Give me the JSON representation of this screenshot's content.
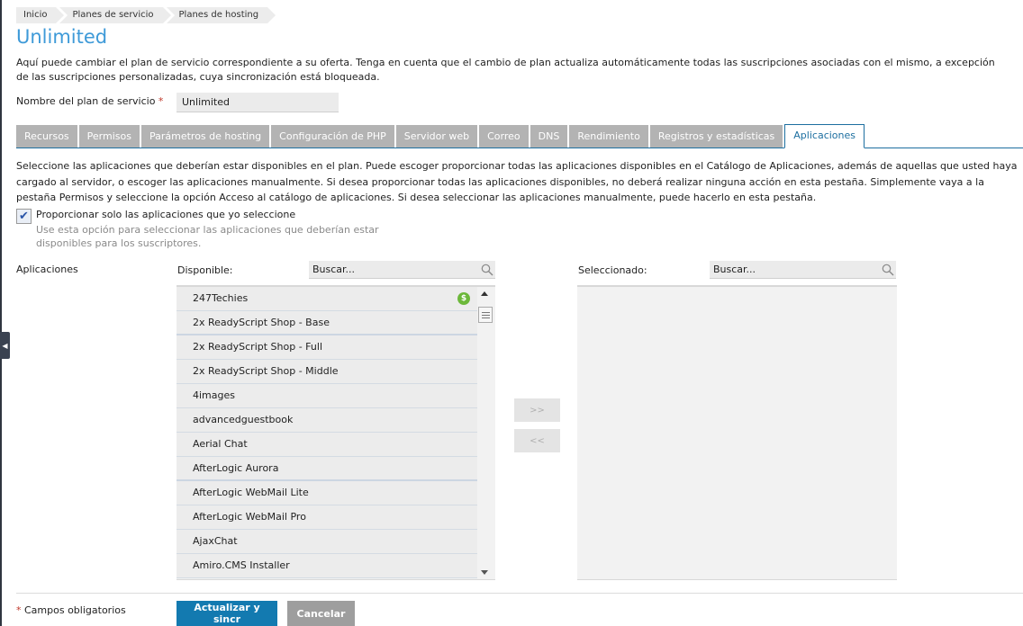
{
  "breadcrumb": [
    "Inicio",
    "Planes de servicio",
    "Planes de hosting"
  ],
  "page": {
    "title": "Unlimited",
    "intro": "Aquí puede cambiar el plan de servicio correspondiente a su oferta. Tenga en cuenta que el cambio de plan actualiza automáticamente todas las suscripciones asociadas con el mismo, a excepción de las suscripciones personalizadas, cuya sincronización está bloqueada."
  },
  "plan_name": {
    "label": "Nombre del plan de servicio",
    "required_mark": "*",
    "value": "Unlimited"
  },
  "tabs": [
    {
      "label": "Recursos",
      "active": false
    },
    {
      "label": "Permisos",
      "active": false
    },
    {
      "label": "Parámetros de hosting",
      "active": false
    },
    {
      "label": "Configuración de PHP",
      "active": false
    },
    {
      "label": "Servidor web",
      "active": false
    },
    {
      "label": "Correo",
      "active": false
    },
    {
      "label": "DNS",
      "active": false
    },
    {
      "label": "Rendimiento",
      "active": false
    },
    {
      "label": "Registros y estadísticas",
      "active": false
    },
    {
      "label": "Aplicaciones",
      "active": true
    }
  ],
  "applications_tab": {
    "description": "Seleccione las aplicaciones que deberían estar disponibles en el plan. Puede escoger proporcionar todas las aplicaciones disponibles en el Catálogo de Aplicaciones, además de aquellas que usted haya cargado al servidor, o escoger las aplicaciones manualmente. Si desea proporcionar todas las aplicaciones disponibles, no deberá realizar ninguna acción en esta pestaña. Simplemente vaya a la pestaña Permisos y seleccione la opción Acceso al catálogo de aplicaciones. Si desea seleccionar las aplicaciones manualmente, puede hacerlo en esta pestaña.",
    "checkbox": {
      "label": "Proporcionar solo las aplicaciones que yo seleccione",
      "checked": true,
      "hint": "Use esta opción para seleccionar las aplicaciones que deberían estar disponibles para los suscriptores."
    },
    "field_label": "Aplicaciones",
    "available": {
      "label": "Disponible:",
      "search_placeholder": "Buscar...",
      "items": [
        {
          "name": "247Techies",
          "paid": true
        },
        {
          "name": "2x ReadyScript Shop - Base",
          "paid": false
        },
        {
          "name": "2x ReadyScript Shop - Full",
          "paid": false
        },
        {
          "name": "2x ReadyScript Shop - Middle",
          "paid": false
        },
        {
          "name": "4images",
          "paid": false
        },
        {
          "name": "advancedguestbook",
          "paid": false
        },
        {
          "name": "Aerial Chat",
          "paid": false
        },
        {
          "name": "AfterLogic Aurora",
          "paid": false
        },
        {
          "name": "AfterLogic WebMail Lite",
          "paid": false
        },
        {
          "name": "AfterLogic WebMail Pro",
          "paid": false
        },
        {
          "name": "AjaxChat",
          "paid": false
        },
        {
          "name": "Amiro.CMS Installer",
          "paid": false
        }
      ],
      "paid_badge": "$"
    },
    "selected": {
      "label": "Seleccionado:",
      "search_placeholder": "Buscar...",
      "items": []
    },
    "add_button": ">>",
    "remove_button": "<<"
  },
  "footer": {
    "required_note": "Campos obligatorios",
    "required_mark": "*",
    "submit_label": "Actualizar y sincr",
    "cancel_label": "Cancelar"
  },
  "colors": {
    "title": "#3e9ad8",
    "tab_active": "#1d6fa0",
    "primary_button": "#137ab0",
    "paid_badge": "#6cb83a"
  }
}
